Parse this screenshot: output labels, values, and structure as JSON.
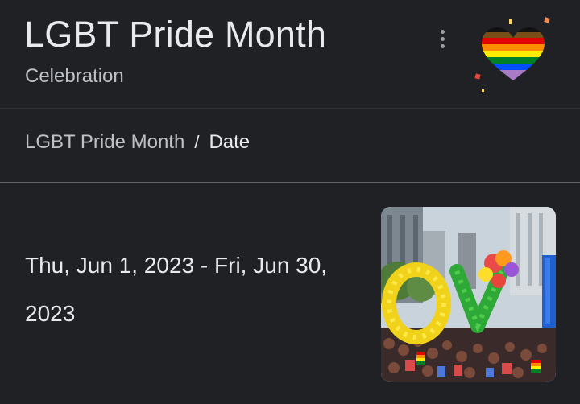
{
  "header": {
    "title": "LGBT Pride Month",
    "subtitle": "Celebration",
    "more_icon": "more-vert-icon",
    "logo_icon": "progress-pride-heart-icon"
  },
  "breadcrumb": {
    "parent": "LGBT Pride Month",
    "separator": "/",
    "current": "Date"
  },
  "event": {
    "date_range": "Thu, Jun 1, 2023 - Fri, Jun 30, 2023"
  },
  "image": {
    "subject": "pride-parade-balloons-photo"
  },
  "colors": {
    "background": "#202124",
    "text_primary": "#e8eaed",
    "text_secondary": "#bdc1c6"
  }
}
